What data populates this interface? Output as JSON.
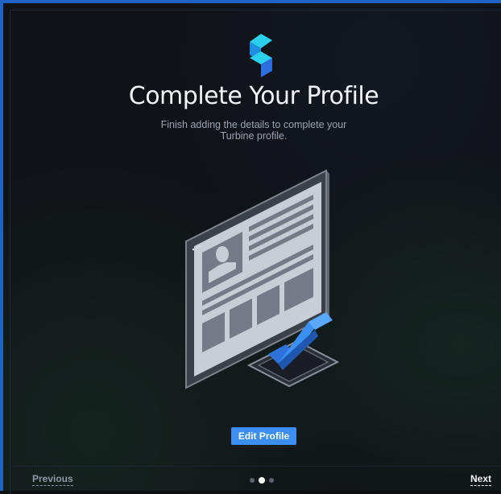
{
  "onboarding": {
    "title": "Complete Your Profile",
    "subtitle_line1": "Finish adding the details to complete your",
    "subtitle_line2": "Turbine profile.",
    "edit_button_label": "Edit Profile",
    "previous_label": "Previous",
    "next_label": "Next",
    "pagination": {
      "total": 3,
      "current": 2
    },
    "icons": [
      "logo-icon",
      "profile-illustration",
      "checkmark-icon"
    ],
    "colors": {
      "accent": "#3a8ff0",
      "logo_cyan": "#22c7e8",
      "logo_blue": "#2e6fe0",
      "frame_border": "#1f63c4",
      "background": "#101217"
    }
  }
}
